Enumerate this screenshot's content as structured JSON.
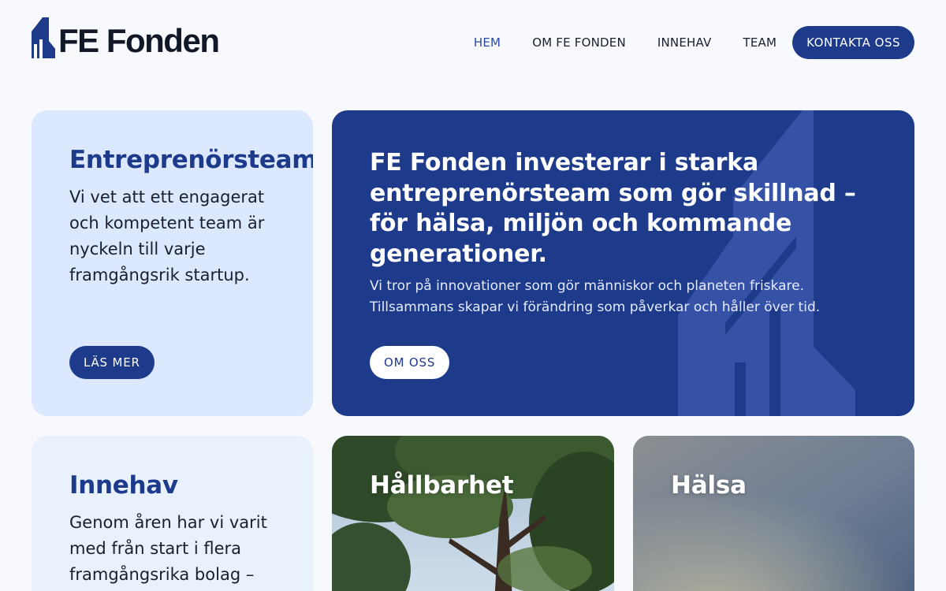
{
  "brand": {
    "name": "FE Fonden",
    "accent": "#1e3a8a",
    "accent_light": "#dbe8fd"
  },
  "nav": {
    "items": [
      {
        "label": "HEM",
        "active": true
      },
      {
        "label": "OM FE FONDEN",
        "active": false
      },
      {
        "label": "INNEHAV",
        "active": false
      },
      {
        "label": "TEAM",
        "active": false
      }
    ],
    "cta": "KONTAKTA OSS"
  },
  "cards": {
    "entre": {
      "title": "Entreprenörsteam",
      "body": "Vi vet att ett engagerat och kompetent team är nyckeln till varje framgångsrik startup.",
      "button": "LÄS MER"
    },
    "hero": {
      "title": "FE Fonden investerar i starka entreprenörsteam som gör skillnad – för hälsa, miljön och kommande generationer.",
      "subtitle": "Vi tror på innovationer som gör människor och planeten friskare. Tillsammans skapar vi förändring som påverkar och håller över tid.",
      "button": "OM OSS"
    },
    "innehav": {
      "title": "Innehav",
      "body": "Genom åren har vi varit med från start i flera framgångsrika bolag –"
    },
    "hallbarhet": {
      "title": "Hållbarhet"
    },
    "halsa": {
      "title": "Hälsa"
    }
  }
}
